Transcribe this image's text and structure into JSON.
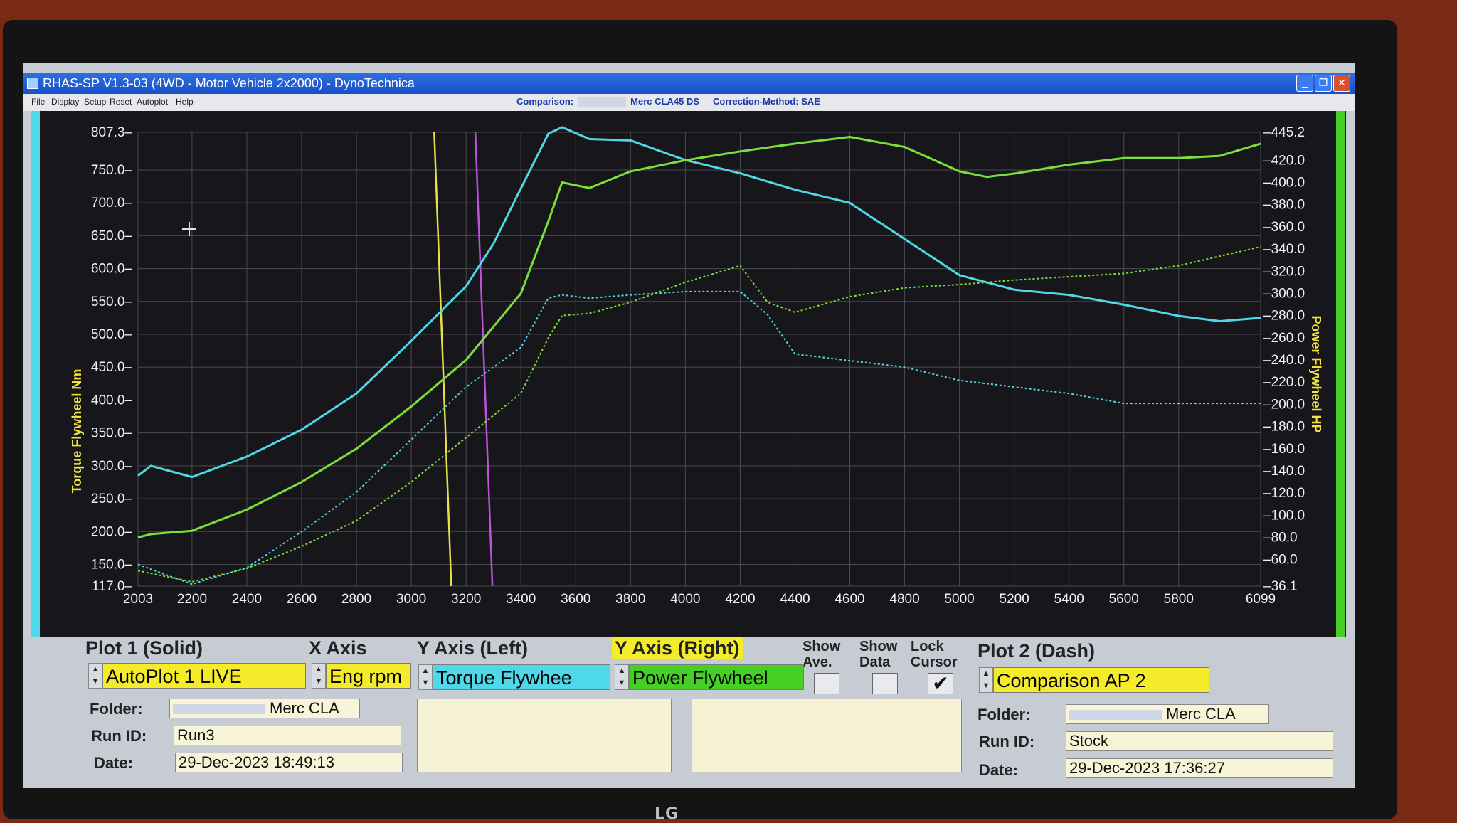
{
  "window": {
    "title": "RHAS-SP V1.3-03  (4WD - Motor Vehicle 2x2000) - DynoTechnica",
    "controls": [
      "_",
      "❐",
      "✕"
    ]
  },
  "menu": [
    "File",
    "Display",
    "Setup",
    "Reset",
    "Autoplot",
    "Help"
  ],
  "info": {
    "comparison_label": "Comparison:",
    "comparison_value": "Merc CLA45 DS",
    "correction": "Correction-Method: SAE"
  },
  "chart_data": {
    "type": "line",
    "x_range": [
      2003,
      6099
    ],
    "x_ticks": [
      "2003",
      "2200",
      "2400",
      "2600",
      "2800",
      "3000",
      "3200",
      "3400",
      "3600",
      "3800",
      "4000",
      "4200",
      "4400",
      "4600",
      "4800",
      "5000",
      "5200",
      "5400",
      "5600",
      "5800",
      "6099"
    ],
    "left_axis": {
      "label": "Torque Flywheel Nm",
      "range": [
        117.0,
        807.3
      ],
      "ticks": [
        "807.3",
        "750.0",
        "700.0",
        "650.0",
        "600.0",
        "550.0",
        "500.0",
        "450.0",
        "400.0",
        "350.0",
        "300.0",
        "250.0",
        "200.0",
        "150.0",
        "117.0"
      ]
    },
    "right_axis": {
      "label": "Power Flywheel HP",
      "range": [
        36.1,
        445.2
      ],
      "ticks": [
        "445.2",
        "420.0",
        "400.0",
        "380.0",
        "360.0",
        "340.0",
        "320.0",
        "300.0",
        "280.0",
        "260.0",
        "240.0",
        "220.0",
        "200.0",
        "180.0",
        "160.0",
        "140.0",
        "120.0",
        "100.0",
        "80.0",
        "60.0",
        "36.1"
      ]
    },
    "cursors": [
      {
        "color": "#e6e04a",
        "x": 3120
      },
      {
        "color": "#c050e0",
        "x": 3270
      }
    ],
    "series": [
      {
        "color": "#4fd8e8",
        "style": "solid",
        "axis": "left",
        "x": [
          2003,
          2050,
          2200,
          2400,
          2600,
          2800,
          3000,
          3200,
          3300,
          3400,
          3500,
          3550,
          3650,
          3800,
          4000,
          4200,
          4400,
          4600,
          4800,
          5000,
          5200,
          5400,
          5600,
          5800,
          5950,
          6099
        ],
        "y": [
          285,
          300,
          283,
          314,
          355,
          410,
          490,
          573,
          638,
          722,
          805,
          815,
          797,
          795,
          765,
          745,
          720,
          700,
          645,
          590,
          568,
          560,
          545,
          528,
          520,
          525
        ]
      },
      {
        "color": "#7de03a",
        "style": "solid",
        "axis": "right",
        "x": [
          2003,
          2050,
          2200,
          2400,
          2600,
          2800,
          3000,
          3200,
          3400,
          3500,
          3550,
          3650,
          3800,
          4000,
          4200,
          4400,
          4600,
          4800,
          5000,
          5100,
          5200,
          5400,
          5600,
          5800,
          5950,
          6099
        ],
        "y": [
          80,
          83,
          86,
          105,
          130,
          160,
          198,
          240,
          300,
          365,
          400,
          395,
          410,
          420,
          428,
          435,
          441,
          432,
          410,
          405,
          408,
          416,
          422,
          422,
          424,
          435
        ]
      },
      {
        "color": "#4fd8e8",
        "style": "dashed",
        "axis": "left",
        "x": [
          2003,
          2100,
          2200,
          2400,
          2600,
          2800,
          3000,
          3200,
          3400,
          3500,
          3550,
          3650,
          3800,
          4000,
          4200,
          4300,
          4400,
          4600,
          4800,
          5000,
          5200,
          5400,
          5600,
          5800,
          6099
        ],
        "y": [
          150,
          135,
          120,
          145,
          200,
          260,
          340,
          420,
          480,
          555,
          560,
          555,
          560,
          565,
          565,
          530,
          470,
          460,
          450,
          430,
          420,
          410,
          395,
          395,
          395
        ]
      },
      {
        "color": "#7de03a",
        "style": "dashed",
        "axis": "right",
        "x": [
          2003,
          2100,
          2200,
          2400,
          2600,
          2800,
          3000,
          3200,
          3400,
          3500,
          3550,
          3650,
          3800,
          4000,
          4200,
          4300,
          4400,
          4600,
          4800,
          5000,
          5200,
          5400,
          5600,
          5800,
          6099
        ],
        "y": [
          50,
          45,
          40,
          52,
          72,
          95,
          130,
          170,
          210,
          260,
          280,
          282,
          292,
          310,
          325,
          292,
          283,
          297,
          305,
          308,
          312,
          315,
          318,
          325,
          342
        ]
      }
    ]
  },
  "panel": {
    "plot1": {
      "header": "Plot 1 (Solid)",
      "selection": "AutoPlot 1 LIVE",
      "folder_label": "Folder:",
      "folder_value": "Merc CLA",
      "run_label": "Run ID:",
      "run_value": "Run3",
      "date_label": "Date:",
      "date_value": "29-Dec-2023   18:49:13"
    },
    "x_axis": {
      "header": "X Axis",
      "selection": "Eng rpm"
    },
    "y_left": {
      "header": "Y Axis (Left)",
      "selection": "Torque Flywhee"
    },
    "y_right": {
      "header": "Y Axis (Right)",
      "selection": "Power Flywheel"
    },
    "show_ave": "Show\nAve.",
    "show_data": "Show\nData",
    "lock_cursor": "Lock\nCursor",
    "plot2": {
      "header": "Plot 2 (Dash)",
      "selection": "Comparison AP 2",
      "folder_label": "Folder:",
      "folder_value": "Merc CLA",
      "run_label": "Run ID:",
      "run_value": "Stock",
      "date_label": "Date:",
      "date_value": "29-Dec-2023   17:36:27"
    }
  },
  "monitor_brand": "LG",
  "colors": {
    "plot_bg": "#17171b",
    "left_bar": "#4fd8e8",
    "right_bar": "#44d024",
    "highlight": "#f4ec2a"
  }
}
